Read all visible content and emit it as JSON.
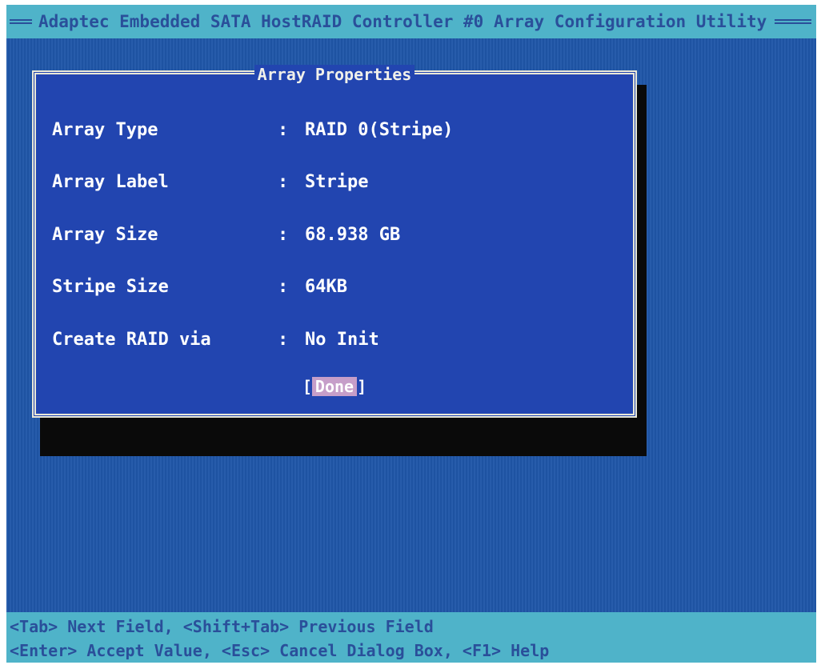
{
  "title_bar": {
    "title": "Adaptec Embedded SATA HostRAID Controller #0 Array Configuration Utility"
  },
  "dialog": {
    "title": "Array Properties",
    "fields": [
      {
        "label": "Array Type",
        "separator": ":",
        "value": "RAID 0(Stripe)"
      },
      {
        "label": "Array Label",
        "separator": ":",
        "value": "Stripe"
      },
      {
        "label": "Array Size",
        "separator": ":",
        "value": "68.938 GB"
      },
      {
        "label": "Stripe Size",
        "separator": ":",
        "value": "64KB"
      },
      {
        "label": "Create RAID via",
        "separator": ":",
        "value": "No Init"
      }
    ],
    "done": {
      "open": "[",
      "label": "Done",
      "close": "]"
    }
  },
  "status_bar": {
    "line1": "<Tab> Next Field, <Shift+Tab> Previous Field",
    "line2": "<Enter> Accept Value, <Esc> Cancel Dialog Box, <F1> Help"
  },
  "colors": {
    "screen_background": "#1f56a8",
    "dialog_background": "#2245b0",
    "bar_background": "#4fb3c9",
    "bar_text": "#2a4f9a",
    "highlight": "#c69ec9"
  }
}
